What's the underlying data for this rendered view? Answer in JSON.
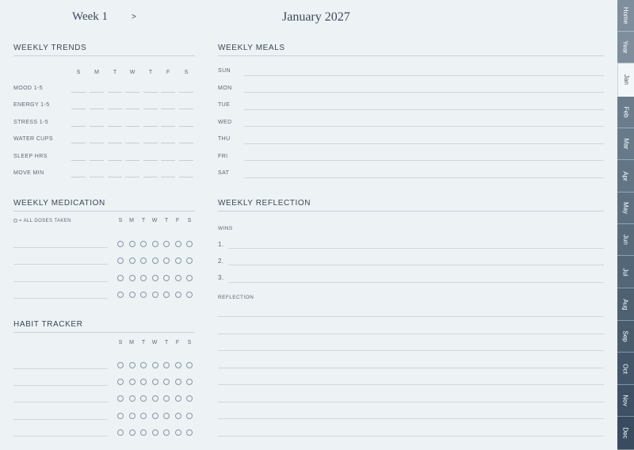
{
  "header": {
    "week": "Week 1",
    "next_arrow": ">",
    "month": "January 2027"
  },
  "trends": {
    "title": "WEEKLY TRENDS",
    "days": [
      "S",
      "M",
      "T",
      "W",
      "T",
      "F",
      "S"
    ],
    "rows": [
      "MOOD 1-5",
      "ENERGY 1-5",
      "STRESS 1-5",
      "WATER CUPS",
      "SLEEP HRS",
      "MOVE MIN"
    ]
  },
  "meals": {
    "title": "WEEKLY MEALS",
    "days": [
      "SUN",
      "MON",
      "TUE",
      "WED",
      "THU",
      "FRI",
      "SAT"
    ]
  },
  "medication": {
    "title": "WEEKLY MEDICATION",
    "legend": "= ALL DOSES TAKEN",
    "days": [
      "S",
      "M",
      "T",
      "W",
      "T",
      "F",
      "S"
    ]
  },
  "reflection": {
    "title": "WEEKLY REFLECTION",
    "wins_label": "WINS",
    "wins": [
      "1.",
      "2.",
      "3."
    ],
    "reflection_label": "REFLECTION"
  },
  "habits": {
    "title": "HABIT TRACKER",
    "days": [
      "S",
      "M",
      "T",
      "W",
      "T",
      "F",
      "S"
    ]
  },
  "tabs": [
    {
      "label": "Home",
      "color": "#7f8e9c"
    },
    {
      "label": "Year",
      "color": "#7f8e9c"
    },
    {
      "label": "Jan",
      "color": "#f3f6f8"
    },
    {
      "label": "Feb",
      "color": "#6b7d8d"
    },
    {
      "label": "Mar",
      "color": "#677a8a"
    },
    {
      "label": "Apr",
      "color": "#627586"
    },
    {
      "label": "May",
      "color": "#5d7082"
    },
    {
      "label": "Jun",
      "color": "#586b7d"
    },
    {
      "label": "Jul",
      "color": "#536678"
    },
    {
      "label": "Aug",
      "color": "#4e6173"
    },
    {
      "label": "Sep",
      "color": "#495c6e"
    },
    {
      "label": "Oct",
      "color": "#435669"
    },
    {
      "label": "Nov",
      "color": "#3e5164"
    },
    {
      "label": "Dec",
      "color": "#394c5f"
    }
  ]
}
